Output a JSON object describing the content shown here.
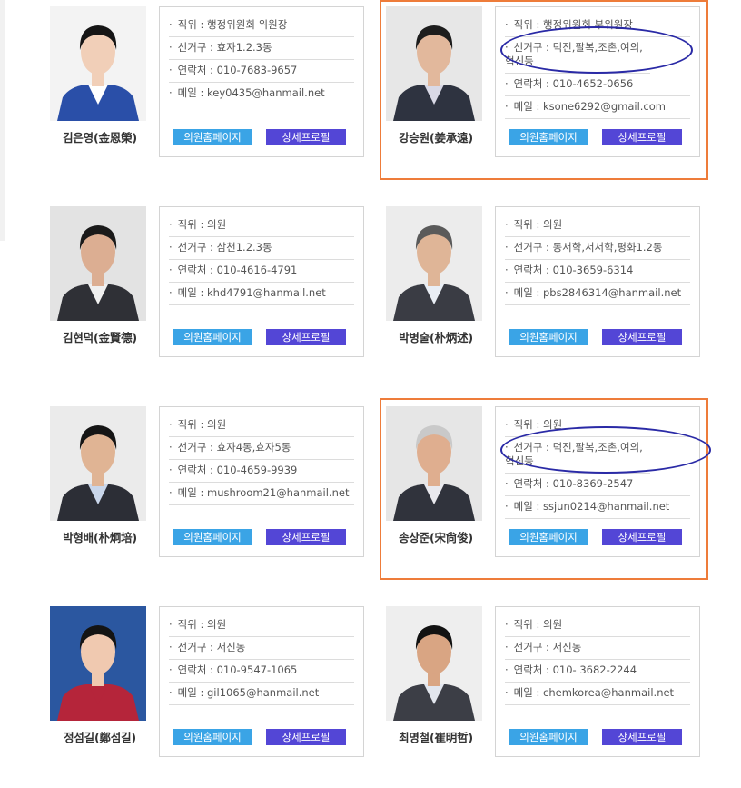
{
  "button_labels": {
    "homepage": "의원홈페이지",
    "profile": "상세프로필"
  },
  "members": [
    {
      "name": "김은영(金恩榮)",
      "position": "직위 : 행정위원회 위원장",
      "district": "선거구 : 효자1.2.3동",
      "contact": "연락처 : 010-7683-9657",
      "email": "메일 : key0435@hanmail.net",
      "photo": {
        "bg": "#f3f3f3",
        "suit": "#2a4fa8",
        "hair": "#151515",
        "skin": "#f1cfb8",
        "shirt": "#ffffff"
      }
    },
    {
      "name": "강승원(姜承遠)",
      "position": "직위 : 행정위원회 부위원장",
      "district": "선거구 : 덕진,팔복,조촌,여의,혁신동",
      "contact": "연락처 : 010-4652-0656",
      "email": "메일 : ksone6292@gmail.com",
      "photo": {
        "bg": "#e7e7e7",
        "suit": "#2e3340",
        "hair": "#1d1d1d",
        "skin": "#e2b89c",
        "shirt": "#d9d9e6"
      }
    },
    {
      "name": "김현덕(金賢德)",
      "position": "직위 : 의원",
      "district": "선거구 : 삼천1.2.3동",
      "contact": "연락처 : 010-4616-4791",
      "email": "메일 : khd4791@hanmail.net",
      "photo": {
        "bg": "#e3e3e3",
        "suit": "#2f3036",
        "hair": "#1a1a1a",
        "skin": "#dcae92",
        "shirt": "#f0f0f0"
      }
    },
    {
      "name": "박병술(朴炳述)",
      "position": "직위 : 의원",
      "district": "선거구 : 동서학,서서학,평화1.2동",
      "contact": "연락처 : 010-3659-6314",
      "email": "메일 : pbs2846314@hanmail.net",
      "photo": {
        "bg": "#ececec",
        "suit": "#3a3c44",
        "hair": "#5a5a5a",
        "skin": "#dfb597",
        "shirt": "#e9eef5"
      }
    },
    {
      "name": "박형배(朴炯培)",
      "position": "직위 : 의원",
      "district": "선거구 : 효자4동,효자5동",
      "contact": "연락처 : 010-4659-9939",
      "email": "메일 : mushroom21@hanmail.net",
      "photo": {
        "bg": "#ebebeb",
        "suit": "#2c2e36",
        "hair": "#151515",
        "skin": "#e0b494",
        "shirt": "#c9d6ea"
      }
    },
    {
      "name": "송상준(宋尙俊)",
      "position": "직위 : 의원",
      "district": "선거구 : 덕진,팔복,조촌,여의,혁신동",
      "contact": "연락처 : 010-8369-2547",
      "email": "메일 : ssjun0214@hanmail.net",
      "photo": {
        "bg": "#e6e6e6",
        "suit": "#30333c",
        "hair": "#c9c9c9",
        "skin": "#dfae8f",
        "shirt": "#e9e9ee"
      }
    },
    {
      "name": "정섬길(鄭섬길)",
      "position": "직위 : 의원",
      "district": "선거구 : 서신동",
      "contact": "연락처 : 010-9547-1065",
      "email": "메일 : gil1065@hanmail.net",
      "photo": {
        "bg": "#2b57a0",
        "suit": "#b5253a",
        "hair": "#141414",
        "skin": "#f0c9b0",
        "shirt": "#b5253a"
      }
    },
    {
      "name": "최명철(崔明哲)",
      "position": "직위 : 의원",
      "district": "선거구 : 서신동",
      "contact": "연락처 : 010- 3682-2244",
      "email": "메일 : chemkorea@hanmail.net",
      "photo": {
        "bg": "#eeeeee",
        "suit": "#3c3e46",
        "hair": "#121212",
        "skin": "#d9a583",
        "shirt": "#e2e6ee"
      }
    }
  ]
}
